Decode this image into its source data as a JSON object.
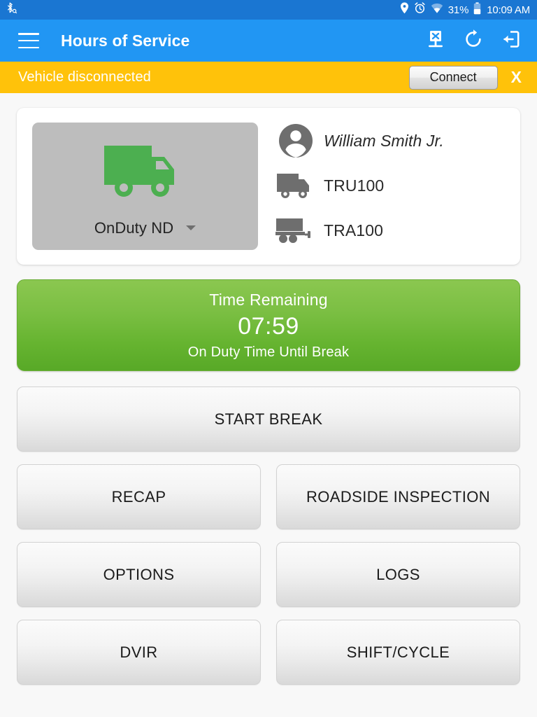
{
  "statusbar": {
    "left_icon": "bluetooth-search-icon",
    "icons": [
      "location-pin-icon",
      "alarm-clock-icon",
      "wifi-icon"
    ],
    "battery_percent": "31%",
    "battery_icon": "battery-icon",
    "clock": "10:09 AM"
  },
  "appbar": {
    "menu_icon": "hamburger-menu-icon",
    "title": "Hours of Service",
    "actions": [
      {
        "icon": "device-disconnected-icon",
        "name": "eld-disconnect-button"
      },
      {
        "icon": "refresh-icon",
        "name": "refresh-button"
      },
      {
        "icon": "logout-icon",
        "name": "logout-button"
      }
    ],
    "bg_color": "#2196f3"
  },
  "banner": {
    "message": "Vehicle disconnected",
    "connect_label": "Connect",
    "close_label": "X",
    "bg_color": "#ffc20a"
  },
  "status_card": {
    "duty_status": {
      "icon": "truck-icon",
      "icon_color": "#4caf50",
      "label": "OnDuty ND",
      "caret_icon": "chevron-down-icon",
      "bg_color": "#bdbdbd"
    },
    "driver": {
      "icon": "person-avatar-icon",
      "name": "William Smith Jr."
    },
    "vehicle": {
      "icon": "truck-icon",
      "id": "TRU100"
    },
    "trailer": {
      "icon": "trailer-icon",
      "id": "TRA100"
    }
  },
  "time_remaining": {
    "title": "Time Remaining",
    "value": "07:59",
    "subtitle": "On Duty Time Until Break",
    "color_top": "#8bc750",
    "color_bottom": "#58a927"
  },
  "actions": {
    "start_break": "START BREAK",
    "recap": "RECAP",
    "roadside_inspection": "ROADSIDE INSPECTION",
    "options": "OPTIONS",
    "logs": "LOGS",
    "dvir": "DVIR",
    "shift_cycle": "SHIFT/CYCLE"
  }
}
